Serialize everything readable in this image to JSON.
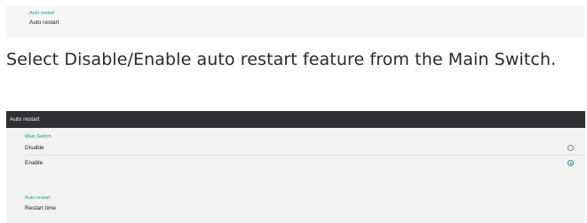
{
  "top_item": {
    "category": "Auto restart",
    "value": "Auto restart"
  },
  "description": "Select Disable/Enable auto restart feature from the Main Switch.",
  "window": {
    "title": "Auto restart",
    "main_switch": {
      "header": "Main Switch",
      "options": [
        {
          "label": "Disable",
          "selected": false
        },
        {
          "label": "Enable",
          "selected": true
        }
      ]
    },
    "auto_restart": {
      "header": "Auto restart",
      "item": "Restart time"
    }
  },
  "colors": {
    "accent": "#1f9e8f",
    "titlebar": "#2e3033",
    "panel": "#f2f2f2"
  }
}
